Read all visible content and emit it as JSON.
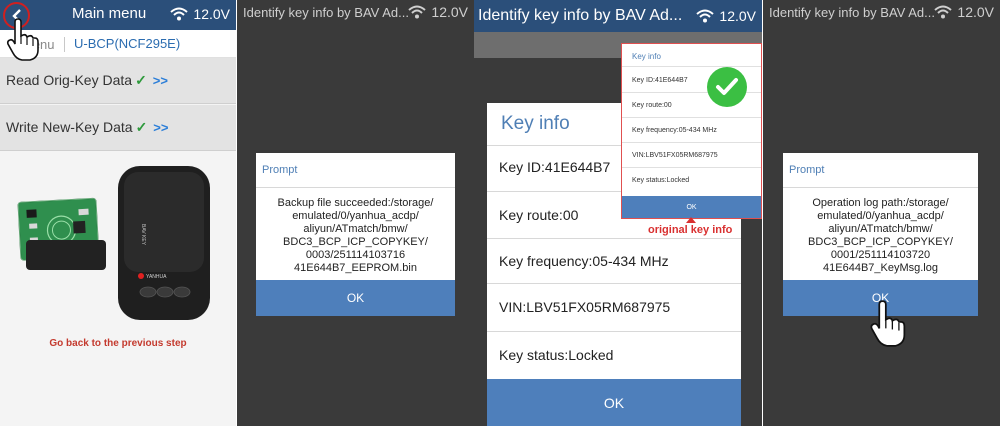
{
  "colors": {
    "header_blue": "#2b4f7a",
    "ok_blue": "#4e7fbb",
    "title_blue": "#4f7fb5",
    "check_green": "#2e9a3c",
    "warning_red": "#c43a2e"
  },
  "panel1": {
    "title": "Main menu",
    "battery": "12.0V",
    "breadcrumb_prev": "menu",
    "breadcrumb_current": "U-BCP(NCF295E)",
    "menu_items": [
      {
        "label": "Read Orig-Key Data",
        "check": "✓",
        "arrow": ">>"
      },
      {
        "label": "Write New-Key Data",
        "check": "✓",
        "arrow": ">>"
      }
    ],
    "device_brand": "BAV KEY",
    "device_logo": "YANHUA",
    "go_back": "Go back to the previous step"
  },
  "panel2": {
    "header_title": "Identify key info by BAV Ad...",
    "battery": "12.0V",
    "dialog_title": "Prompt",
    "message_lines": [
      "Backup file succeeded:/storage/",
      "emulated/0/yanhua_acdp/",
      "aliyun/ATmatch/bmw/",
      "BDC3_BCP_ICP_COPYKEY/",
      "0003/251114103716",
      "41E644B7_EEPROM.bin"
    ],
    "ok_label": "OK"
  },
  "panel3": {
    "header_title": "Identify key info by BAV Ad...",
    "battery": "12.0V",
    "dialog_title": "Key info",
    "rows": [
      "Key ID:41E644B7",
      "Key route:00",
      "Key frequency:05-434 MHz",
      "VIN:LBV51FX05RM687975",
      "Key status:Locked"
    ],
    "ok_label": "OK",
    "mini_title": "Key info",
    "mini_rows": [
      "Key ID:41E644B7",
      "Key route:00",
      "Key frequency:05-434 MHz",
      "VIN:LBV51FX05RM687975",
      "Key status:Locked"
    ],
    "mini_ok": "OK",
    "annotation": "original key info"
  },
  "panel4": {
    "header_title": "Identify key info by BAV Ad...",
    "battery": "12.0V",
    "dialog_title": "Prompt",
    "message_lines": [
      "Operation log path:/storage/",
      "emulated/0/yanhua_acdp/",
      "aliyun/ATmatch/bmw/",
      "BDC3_BCP_ICP_COPYKEY/",
      "0001/251114103720",
      "41E644B7_KeyMsg.log"
    ],
    "ok_label": "OK"
  }
}
